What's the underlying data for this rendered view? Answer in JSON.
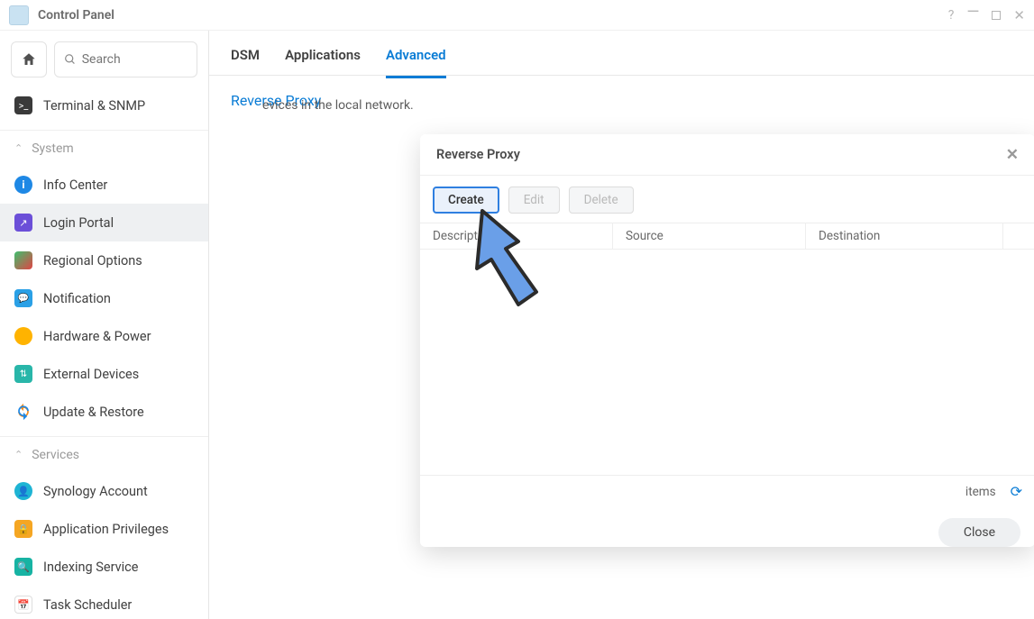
{
  "window": {
    "title": "Control Panel"
  },
  "search": {
    "placeholder": "Search"
  },
  "sidebar": {
    "top_item": "Terminal & SNMP",
    "section_system": "System",
    "system_items": [
      {
        "label": "Info Center"
      },
      {
        "label": "Login Portal"
      },
      {
        "label": "Regional Options"
      },
      {
        "label": "Notification"
      },
      {
        "label": "Hardware & Power"
      },
      {
        "label": "External Devices"
      },
      {
        "label": "Update & Restore"
      }
    ],
    "section_services": "Services",
    "service_items": [
      {
        "label": "Synology Account"
      },
      {
        "label": "Application Privileges"
      },
      {
        "label": "Indexing Service"
      },
      {
        "label": "Task Scheduler"
      }
    ]
  },
  "tabs": {
    "dsm": "DSM",
    "applications": "Applications",
    "advanced": "Advanced"
  },
  "page": {
    "section_title": "Reverse Proxy",
    "section_desc_tail": "evices in the local network."
  },
  "modal": {
    "title": "Reverse Proxy",
    "create": "Create",
    "edit": "Edit",
    "delete": "Delete",
    "col_description": "Description",
    "col_source": "Source",
    "col_destination": "Destination",
    "items_label": "items",
    "close": "Close"
  }
}
